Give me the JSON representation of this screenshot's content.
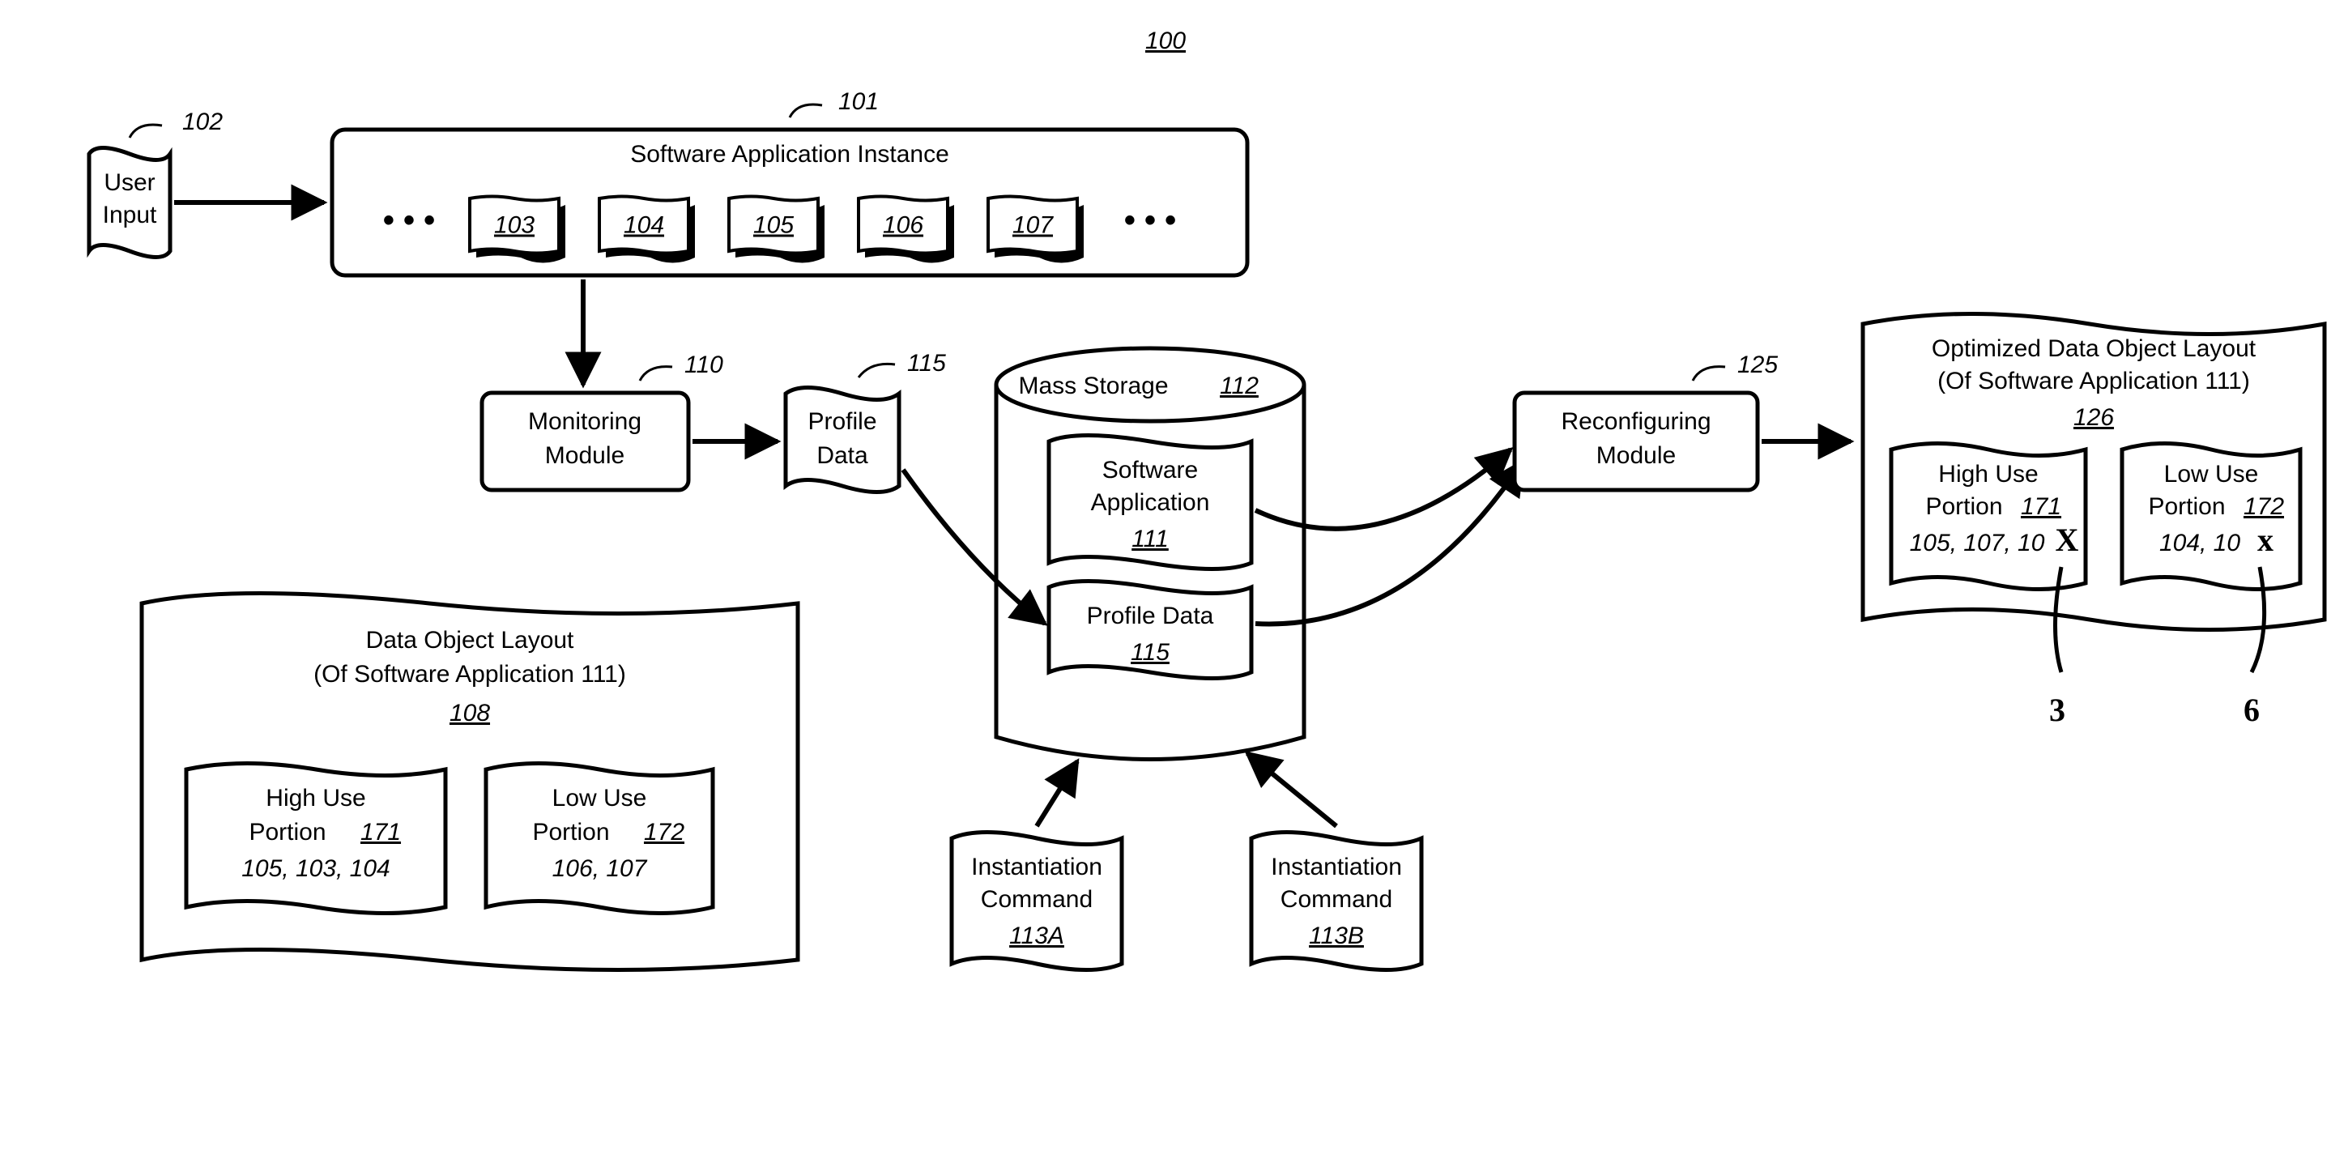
{
  "figure_ref": "100",
  "user_input": {
    "label": "User\nInput",
    "ref": "102"
  },
  "app_instance": {
    "title": "Software Application Instance",
    "ref": "101",
    "items": [
      "103",
      "104",
      "105",
      "106",
      "107"
    ]
  },
  "monitoring": {
    "label": "Monitoring\nModule",
    "ref": "110"
  },
  "profile": {
    "label": "Profile\nData",
    "ref": "115"
  },
  "storage": {
    "title": "Mass Storage",
    "ref": "112",
    "app": {
      "label": "Software\nApplication",
      "ref": "111"
    },
    "profile": {
      "label": "Profile Data",
      "ref": "115"
    }
  },
  "inst_a": {
    "label": "Instantiation\nCommand",
    "ref": "113A"
  },
  "inst_b": {
    "label": "Instantiation\nCommand",
    "ref": "113B"
  },
  "reconfig": {
    "label": "Reconfiguring\nModule",
    "ref": "125"
  },
  "layout": {
    "title": "Data Object Layout",
    "subtitle": "(Of Software Application 111)",
    "ref": "108",
    "high": {
      "label": "High Use\nPortion",
      "ref": "171",
      "items": "105, 103, 104"
    },
    "low": {
      "label": "Low Use\nPortion",
      "ref": "172",
      "items": "106, 107"
    }
  },
  "opt_layout": {
    "title": "Optimized Data Object Layout",
    "subtitle": "(Of Software Application 111)",
    "ref": "126",
    "high": {
      "label": "High Use\nPortion",
      "ref": "171",
      "items": "105, 107, 10"
    },
    "low": {
      "label": "Low Use\nPortion",
      "ref": "172",
      "items": "104, 10"
    },
    "annot_high": "3",
    "annot_low": "6",
    "strike_high": "X",
    "strike_low": "x"
  }
}
